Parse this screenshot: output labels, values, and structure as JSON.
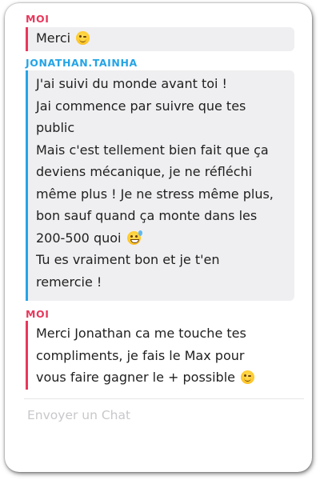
{
  "conversation": {
    "messages": [
      {
        "sender": "MOI",
        "sender_color": "#e8375b",
        "lines": [
          "Merci"
        ],
        "emoji": "wink-face-icon"
      },
      {
        "sender": "JONATHAN.TAINHA",
        "sender_color": "#25a4e6",
        "lines": [
          "J'ai suivi du monde avant toi !",
          "Jai commence par suivre que tes",
          "public",
          "Mais c'est tellement bien fait que ça",
          "deviens mécanique, je ne réfléchi",
          "même plus ! Je ne stress même plus,",
          "bon sauf quand ça monte dans les",
          "200-500 quoi",
          "Tu es vraiment bon et je t'en",
          "remercie !"
        ],
        "emoji": "grinning-sweat-face-icon"
      },
      {
        "sender": "MOI",
        "sender_color": "#e8375b",
        "lines": [
          "Merci Jonathan ca me touche tes",
          "compliments, je fais le Max pour",
          "vous faire gagner le + possible"
        ],
        "emoji": "wink-face-icon"
      }
    ]
  },
  "composer": {
    "placeholder": "Envoyer un Chat"
  }
}
